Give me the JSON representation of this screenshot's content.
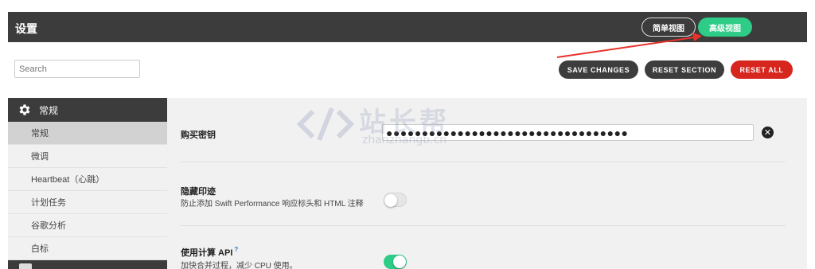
{
  "header": {
    "title": "设置",
    "view_simple": "简单视图",
    "view_advanced": "高级视图"
  },
  "toolbar": {
    "search_placeholder": "Search",
    "save_label": "SAVE CHANGES",
    "reset_section_label": "RESET SECTION",
    "reset_all_label": "RESET ALL"
  },
  "sidebar": {
    "section_title": "常规",
    "items": [
      {
        "label": "常规",
        "active": true
      },
      {
        "label": "微调",
        "active": false
      },
      {
        "label": "Heartbeat（心跳）",
        "active": false
      },
      {
        "label": "计划任务",
        "active": false
      },
      {
        "label": "谷歌分析",
        "active": false
      },
      {
        "label": "白标",
        "active": false
      }
    ]
  },
  "settings": {
    "purchase_key": {
      "label": "购买密钥",
      "value": "●●●●●●●●●●●●●●●●●●●●●●●●●●●●●●●●●●",
      "clear_icon": "close-circle-icon"
    },
    "hide_footprint": {
      "label": "隐藏印迹",
      "description": "防止添加 Swift Performance 响应标头和 HTML 注释",
      "enabled": false
    },
    "compute_api": {
      "label": "使用计算 API",
      "help": "?",
      "description": "加快合并过程，减少 CPU 使用。",
      "enabled": true
    }
  },
  "watermark": {
    "text": "站长帮",
    "url": "zhanzhangb.cn"
  },
  "colors": {
    "dark": "#3c3c3c",
    "accent_green": "#2ecc87",
    "danger_red": "#d6261d",
    "annotation_arrow": "#e8332a"
  }
}
